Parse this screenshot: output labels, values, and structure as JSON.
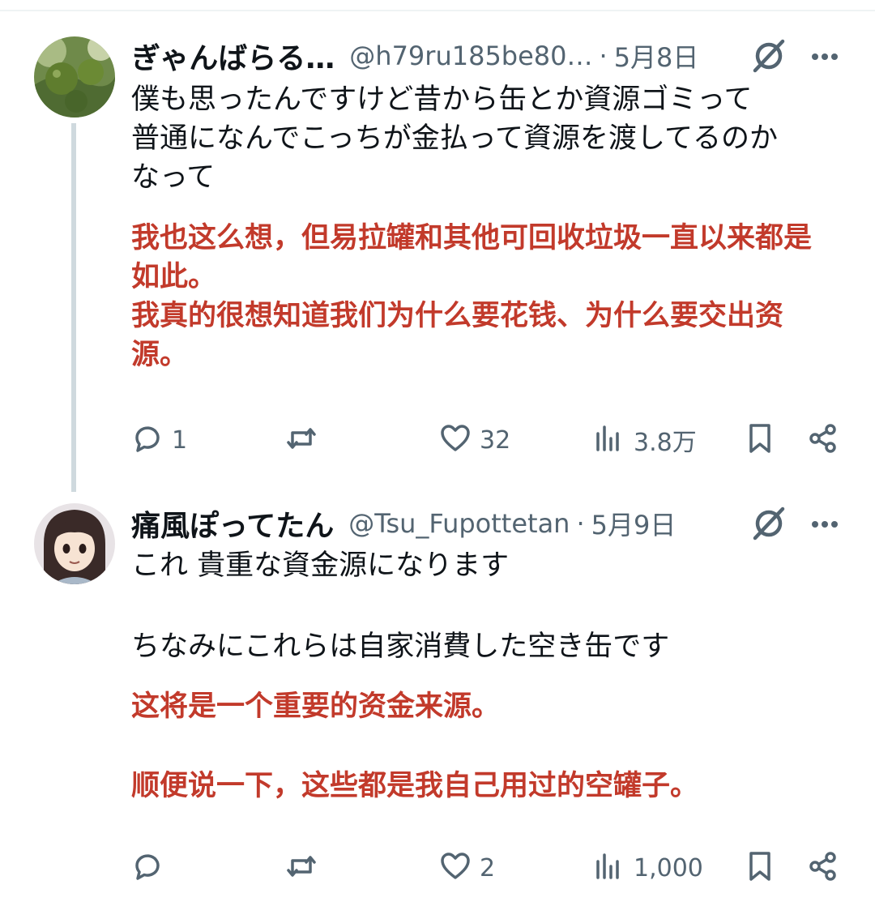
{
  "tweets": [
    {
      "name": "ぎゃんばらる…",
      "handle": "@h79ru185be80…",
      "separator": "·",
      "date": "5月8日",
      "text_lines": [
        "僕も思ったんですけど昔から缶とか資源ゴミって",
        "普通になんでこっちが金払って資源を渡してるのか",
        "なって"
      ],
      "translation_lines": [
        "我也这么想，但易拉罐和其他可回收垃圾一直以来都是",
        "如此。",
        "我真的很想知道我们为什么要花钱、为什么要交出资",
        "源。"
      ],
      "stats": {
        "replies": "1",
        "retweets": "",
        "likes": "32",
        "views": "3.8万"
      }
    },
    {
      "name": "痛風ぽってたん",
      "handle": "@Tsu_Fupottetan",
      "separator": "·",
      "date": "5月9日",
      "text_lines": [
        "これ 貴重な資金源になります",
        "",
        "ちなみにこれらは自家消費した空き缶です"
      ],
      "translation_lines": [
        "这将是一个重要的资金来源。",
        "",
        "顺便说一下，这些都是我自己用过的空罐子。"
      ],
      "stats": {
        "replies": "",
        "retweets": "",
        "likes": "2",
        "views": "1,000"
      }
    }
  ],
  "colors": {
    "text": "#0f1419",
    "secondary": "#536471",
    "translation": "#c23a2b",
    "thread_line": "#cfd9de"
  },
  "icons": {
    "grok": "grok-icon",
    "more": "more-icon",
    "reply": "reply-icon",
    "retweet": "retweet-icon",
    "like": "like-icon",
    "views": "views-icon",
    "bookmark": "bookmark-icon",
    "share": "share-icon"
  }
}
